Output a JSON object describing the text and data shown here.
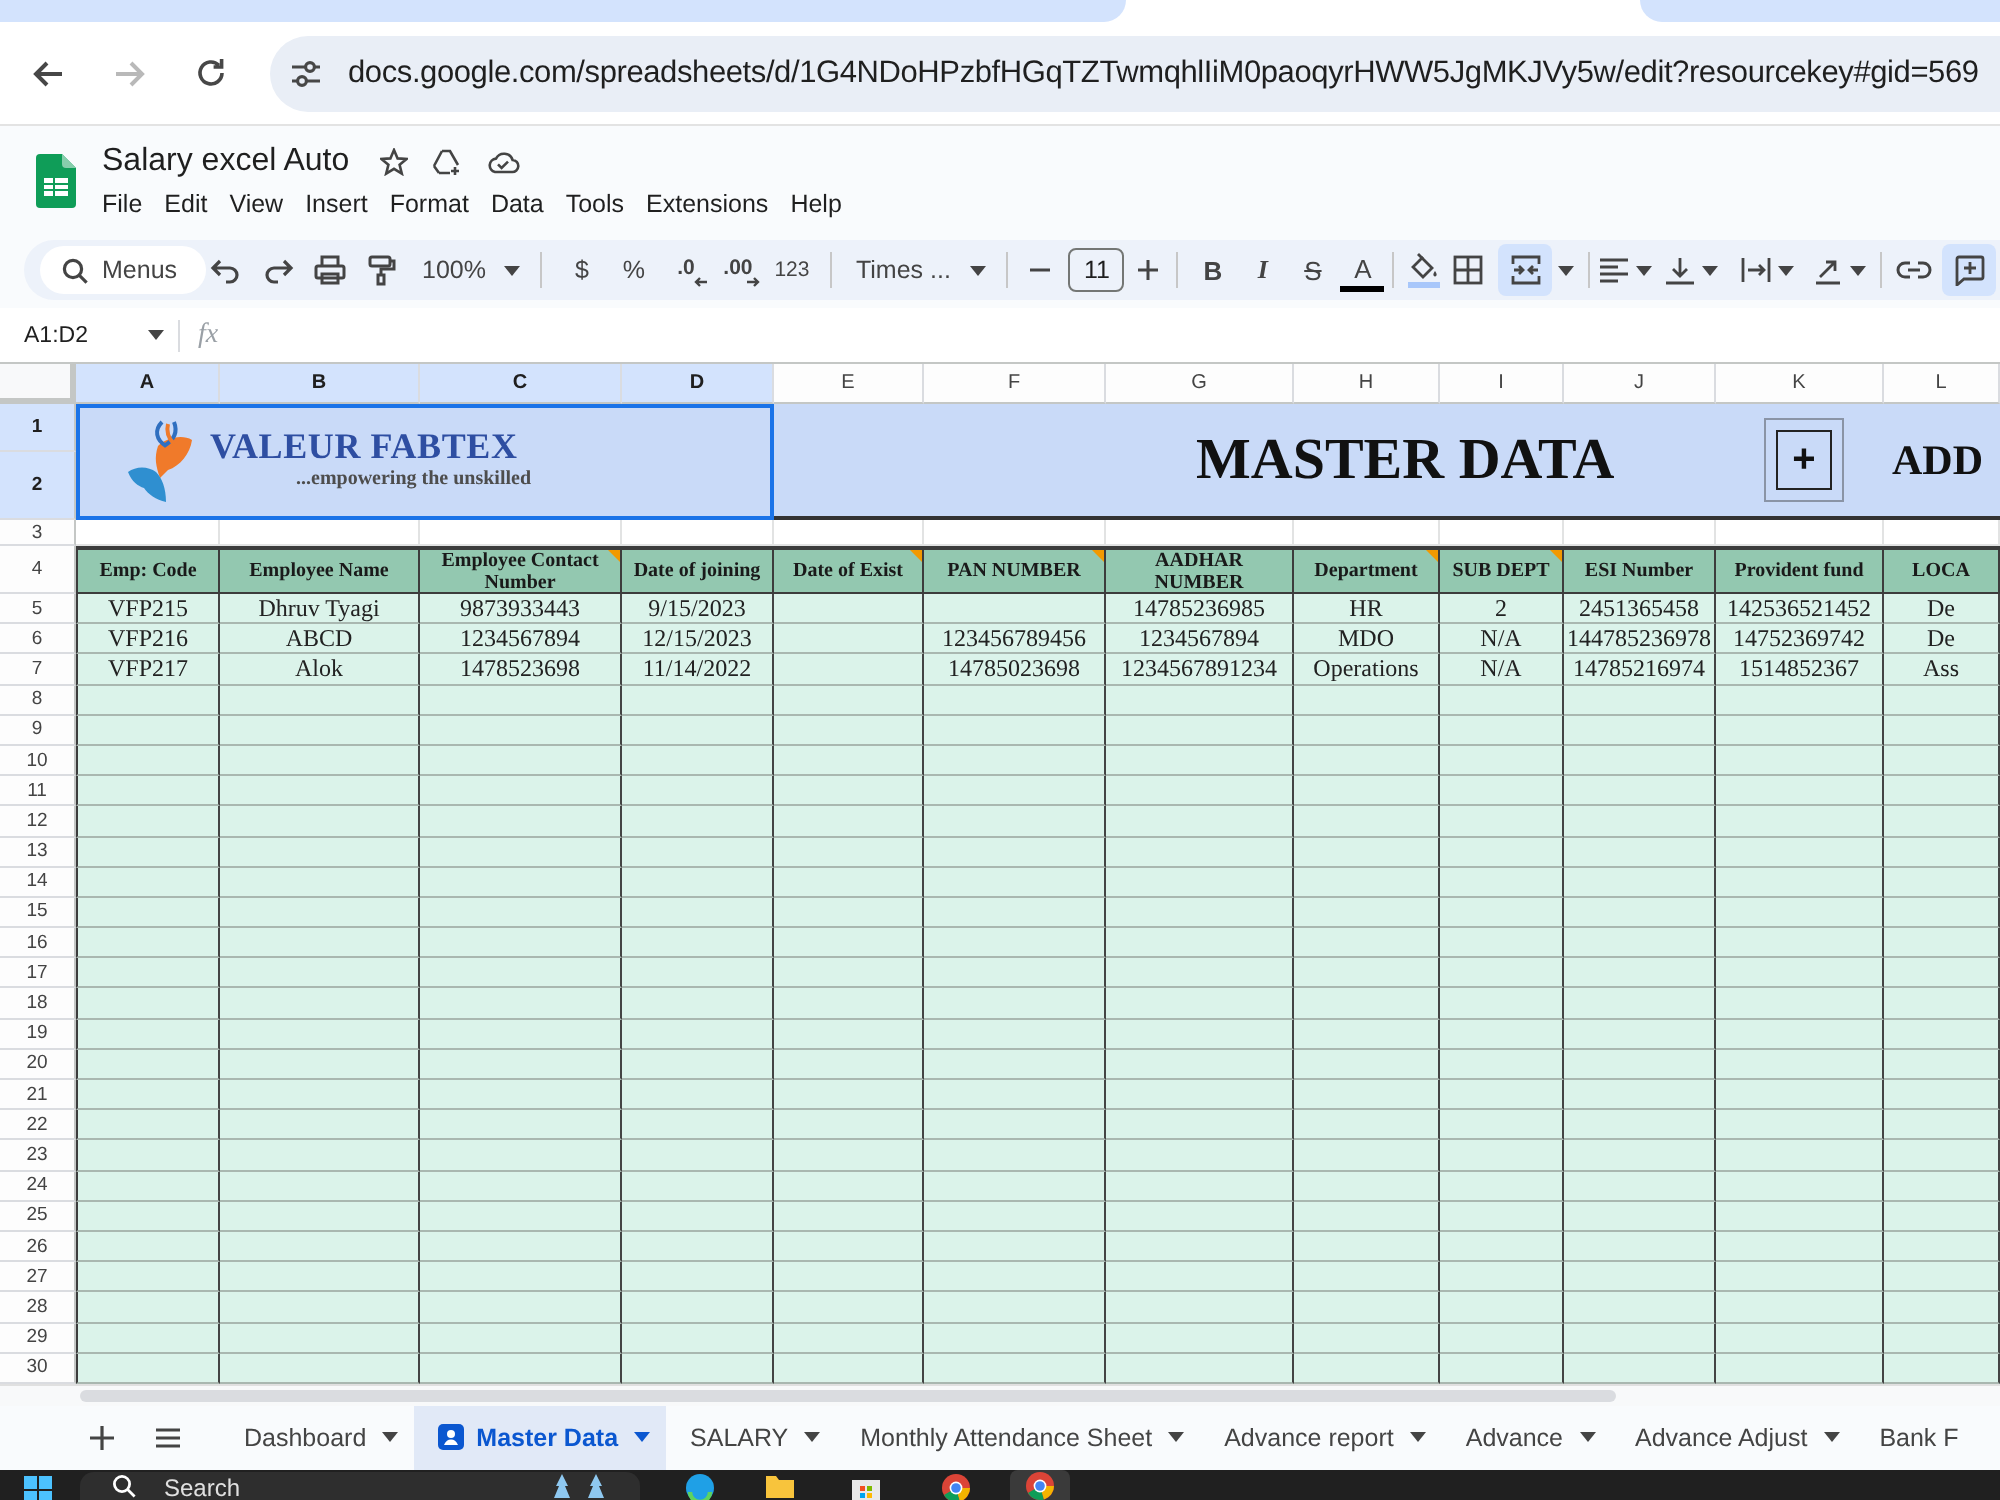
{
  "browser": {
    "url": "docs.google.com/spreadsheets/d/1G4NDoHPzbfHGqTZTwmqhlIiM0paoqyrHWW5JgMKJVy5w/edit?resourcekey#gid=569",
    "back_enabled": true,
    "forward_enabled": false
  },
  "document": {
    "title": "Salary excel Auto",
    "menu": [
      "File",
      "Edit",
      "View",
      "Insert",
      "Format",
      "Data",
      "Tools",
      "Extensions",
      "Help"
    ]
  },
  "toolbar": {
    "search": {
      "placeholder": "Menus"
    },
    "zoom": "100%",
    "currency": "$",
    "percent": "%",
    "decrease_decimals": ".0",
    "increase_decimals": ".00",
    "number_format": "123",
    "font": "Times ...",
    "font_size": "11",
    "bold": "B",
    "italic": "I",
    "strikethrough": "S",
    "text_color": "A",
    "merge_selected": true,
    "comment_selected": true
  },
  "formula_bar": {
    "cell_range": "A1:D2",
    "function_label": "fx"
  },
  "sheet": {
    "columns": [
      {
        "letter": "A",
        "selected": true
      },
      {
        "letter": "B",
        "selected": true
      },
      {
        "letter": "C",
        "selected": true
      },
      {
        "letter": "D",
        "selected": true
      },
      {
        "letter": "E",
        "selected": false
      },
      {
        "letter": "F",
        "selected": false
      },
      {
        "letter": "G",
        "selected": false
      },
      {
        "letter": "H",
        "selected": false
      },
      {
        "letter": "I",
        "selected": false
      },
      {
        "letter": "J",
        "selected": false
      },
      {
        "letter": "K",
        "selected": false
      },
      {
        "letter": "L",
        "selected": false
      }
    ],
    "rows": [
      {
        "label": "1",
        "selected": true
      },
      {
        "label": "2",
        "selected": true
      },
      {
        "label": "3",
        "selected": false
      },
      {
        "label": "4",
        "selected": false
      },
      {
        "label": "5",
        "selected": false
      },
      {
        "label": "6",
        "selected": false
      },
      {
        "label": "7",
        "selected": false
      },
      {
        "label": "8",
        "selected": false
      },
      {
        "label": "9",
        "selected": false
      },
      {
        "label": "10",
        "selected": false
      },
      {
        "label": "11",
        "selected": false
      },
      {
        "label": "12",
        "selected": false
      },
      {
        "label": "13",
        "selected": false
      },
      {
        "label": "14",
        "selected": false
      },
      {
        "label": "15",
        "selected": false
      },
      {
        "label": "16",
        "selected": false
      },
      {
        "label": "17",
        "selected": false
      },
      {
        "label": "18",
        "selected": false
      },
      {
        "label": "19",
        "selected": false
      },
      {
        "label": "20",
        "selected": false
      },
      {
        "label": "21",
        "selected": false
      },
      {
        "label": "22",
        "selected": false
      },
      {
        "label": "23",
        "selected": false
      },
      {
        "label": "24",
        "selected": false
      },
      {
        "label": "25",
        "selected": false
      },
      {
        "label": "26",
        "selected": false
      },
      {
        "label": "27",
        "selected": false
      },
      {
        "label": "28",
        "selected": false
      },
      {
        "label": "29",
        "selected": false
      },
      {
        "label": "30",
        "selected": false
      }
    ]
  },
  "banner": {
    "logo_selected": true,
    "logo_name": "VALEUR FABTEX",
    "logo_tagline": "...empowering the unskilled",
    "title": "MASTER DATA",
    "add_button": "+",
    "add_label": "ADD"
  },
  "table": {
    "columns": [
      {
        "label": "Emp: Code",
        "note": false
      },
      {
        "label": "Employee Name",
        "note": false
      },
      {
        "label": "Employee Contact Number",
        "note": true
      },
      {
        "label": "Date of joining",
        "note": false
      },
      {
        "label": "Date of Exist",
        "note": true
      },
      {
        "label": "PAN NUMBER",
        "note": true
      },
      {
        "label": "AADHAR NUMBER",
        "note": false
      },
      {
        "label": "Department",
        "note": true
      },
      {
        "label": "SUB DEPT",
        "note": true
      },
      {
        "label": "ESI Number",
        "note": false
      },
      {
        "label": "Provident fund",
        "note": false
      },
      {
        "label": "LOCA",
        "note": false
      }
    ],
    "rows": [
      {
        "A": "VFP215",
        "B": "Dhruv Tyagi",
        "C": "9873933443",
        "D": "9/15/2023",
        "G": "14785236985",
        "H": "HR",
        "I": "2",
        "J": "2451365458",
        "K": "142536521452",
        "L": "De"
      },
      {
        "A": "VFP216",
        "B": "ABCD",
        "C": "1234567894",
        "D": "12/15/2023",
        "F": "123456789456",
        "G": "1234567894",
        "H": "MDO",
        "I": "N/A",
        "J": "144785236978",
        "K": "14752369742",
        "L": "De"
      },
      {
        "A": "VFP217",
        "B": "Alok",
        "C": "1478523698",
        "D": "11/14/2022",
        "F": "14785023698",
        "G": "1234567891234",
        "H": "Operations",
        "I": "N/A",
        "J": "14785216974",
        "K": "1514852367",
        "L": "Ass"
      }
    ]
  },
  "sheet_tabs": [
    {
      "label": "Dashboard",
      "selected": false,
      "badge": false,
      "menu": true
    },
    {
      "label": "Master Data",
      "selected": true,
      "badge": true,
      "menu": true
    },
    {
      "label": "SALARY",
      "selected": false,
      "badge": false,
      "menu": true
    },
    {
      "label": "Monthly Attendance Sheet",
      "selected": false,
      "badge": false,
      "menu": true
    },
    {
      "label": "Advance report",
      "selected": false,
      "badge": false,
      "menu": true
    },
    {
      "label": "Advance",
      "selected": false,
      "badge": false,
      "menu": true
    },
    {
      "label": "Advance Adjust",
      "selected": false,
      "badge": false,
      "menu": true
    },
    {
      "label": "Bank F",
      "selected": false,
      "badge": false,
      "menu": false
    }
  ],
  "taskbar": {
    "search": {
      "placeholder": "Search"
    }
  }
}
